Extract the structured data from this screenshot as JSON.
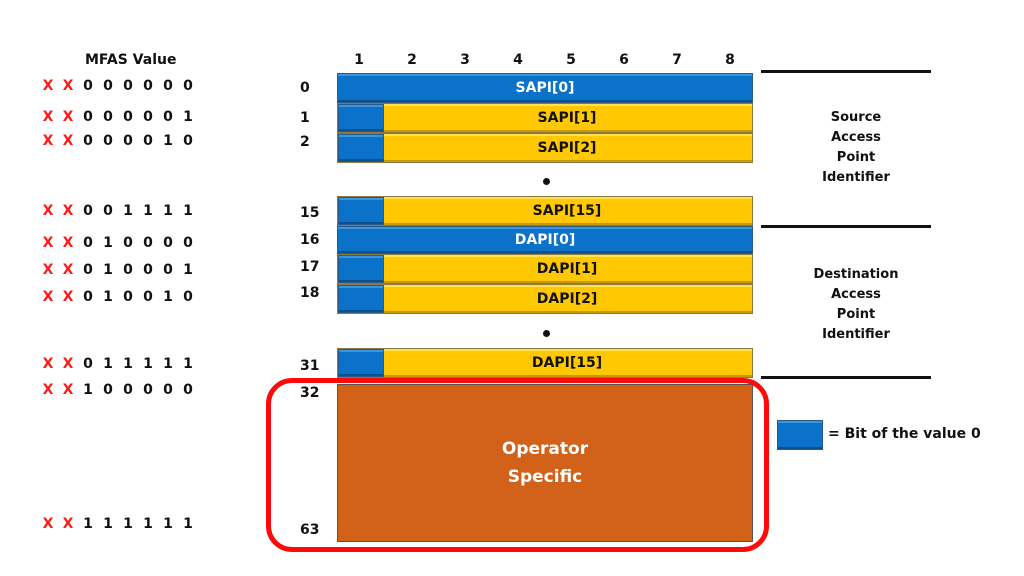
{
  "mfas": {
    "title": "MFAS Value",
    "rows": [
      {
        "bits": [
          "X",
          "X",
          "0",
          "0",
          "0",
          "0",
          "0",
          "0"
        ],
        "frame": "0"
      },
      {
        "bits": [
          "X",
          "X",
          "0",
          "0",
          "0",
          "0",
          "0",
          "1"
        ],
        "frame": "1"
      },
      {
        "bits": [
          "X",
          "X",
          "0",
          "0",
          "0",
          "0",
          "1",
          "0"
        ],
        "frame": "2"
      },
      {
        "bits": [
          "X",
          "X",
          "0",
          "0",
          "1",
          "1",
          "1",
          "1"
        ],
        "frame": "15"
      },
      {
        "bits": [
          "X",
          "X",
          "0",
          "1",
          "0",
          "0",
          "0",
          "0"
        ],
        "frame": "16"
      },
      {
        "bits": [
          "X",
          "X",
          "0",
          "1",
          "0",
          "0",
          "0",
          "1"
        ],
        "frame": "17"
      },
      {
        "bits": [
          "X",
          "X",
          "0",
          "1",
          "0",
          "0",
          "1",
          "0"
        ],
        "frame": "18"
      },
      {
        "bits": [
          "X",
          "X",
          "0",
          "1",
          "1",
          "1",
          "1",
          "1"
        ],
        "frame": "31"
      },
      {
        "bits": [
          "X",
          "X",
          "1",
          "0",
          "0",
          "0",
          "0",
          "0"
        ],
        "frame": "32"
      },
      {
        "bits": [
          "X",
          "X",
          "1",
          "1",
          "1",
          "1",
          "1",
          "1"
        ],
        "frame": "63"
      }
    ]
  },
  "columns": [
    "1",
    "2",
    "3",
    "4",
    "5",
    "6",
    "7",
    "8"
  ],
  "bars": {
    "sapi0": "SAPI[0]",
    "sapi1": "SAPI[1]",
    "sapi2": "SAPI[2]",
    "sapi15": "SAPI[15]",
    "dapi0": "DAPI[0]",
    "dapi1": "DAPI[1]",
    "dapi2": "DAPI[2]",
    "dapi15": "DAPI[15]"
  },
  "operator": {
    "line1": "Operator",
    "line2": "Specific"
  },
  "source_label": [
    "Source",
    "Access",
    "Point",
    "Identifier"
  ],
  "dest_label": [
    "Destination",
    "Access",
    "Point",
    "Identifier"
  ],
  "legend": {
    "text": "= Bit of the value  0"
  },
  "colors": {
    "blue": "#0a72c8",
    "yellow": "#ffc800",
    "orange": "#d2621a",
    "red": "#ff0a0a"
  }
}
